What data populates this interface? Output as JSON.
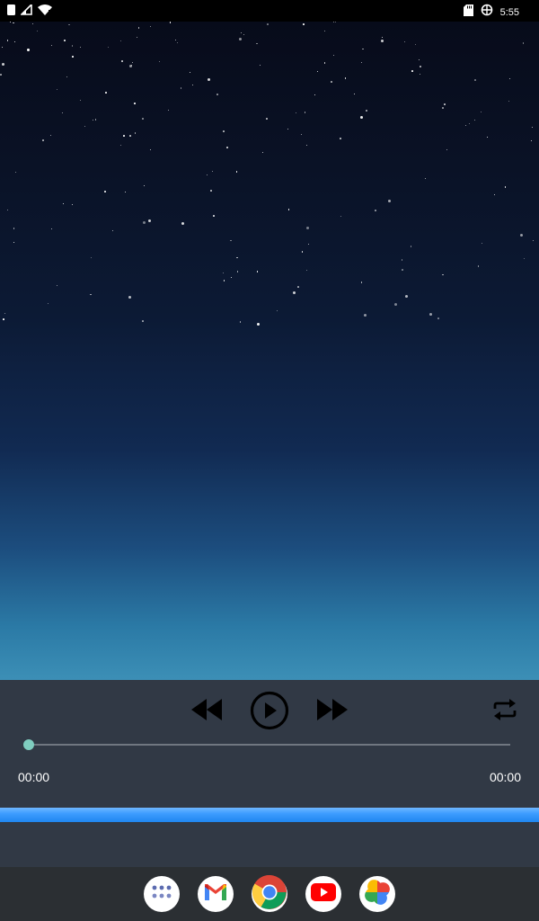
{
  "status_bar": {
    "time": "5:55",
    "left_icons": [
      "notification-icon",
      "signal-icon",
      "wifi-icon"
    ],
    "right_icons": [
      "sd-card-icon",
      "sync-icon"
    ]
  },
  "player": {
    "elapsed": "00:00",
    "total": "00:00",
    "progress": 0,
    "controls": [
      "rewind-icon",
      "play-icon",
      "fast-forward-icon",
      "repeat-icon"
    ],
    "accent_color": "#7fcdbf"
  },
  "dock": {
    "apps": [
      "app-drawer",
      "gmail",
      "chrome",
      "youtube",
      "photos"
    ]
  },
  "colors": {
    "player_bg": "#313945",
    "highlight_bar": "#3e9dff",
    "dock_bg": "#2b2f33"
  }
}
